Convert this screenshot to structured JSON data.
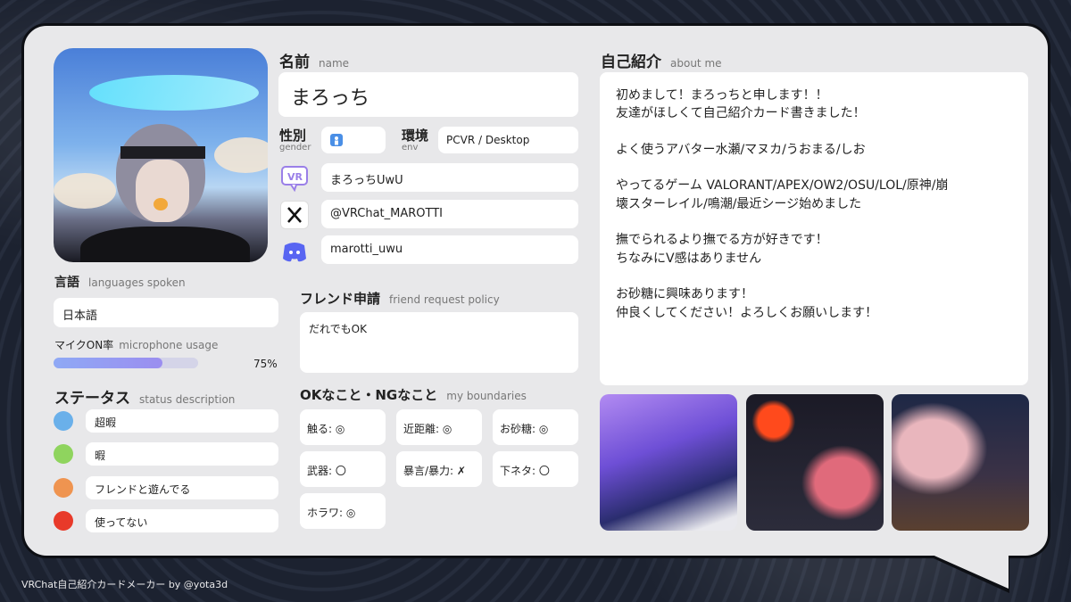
{
  "footer": "VRChat自己紹介カードメーカー by @yota3d",
  "name": {
    "label": "名前",
    "sub": "name",
    "value": "まろっち"
  },
  "gender": {
    "label": "性別",
    "sub": "gender",
    "icon": "male-symbol-icon"
  },
  "env": {
    "label": "環境",
    "sub": "env",
    "value": "PCVR / Desktop"
  },
  "accounts": {
    "vrchat": "まろっちUwU",
    "x": "@VRChat_MAROTTI",
    "discord": "marotti_uwu"
  },
  "languages": {
    "label": "言語",
    "sub": "languages spoken",
    "value": "日本語"
  },
  "mic": {
    "label": "マイクON率",
    "sub": "microphone usage",
    "value": "75%",
    "fraction": 0.75
  },
  "status": {
    "label": "ステータス",
    "sub": "status description",
    "items": [
      {
        "color": "#6ab0ea",
        "text": "超暇"
      },
      {
        "color": "#8fd45e",
        "text": "暇"
      },
      {
        "color": "#ef9450",
        "text": "フレンドと遊んでる"
      },
      {
        "color": "#e83a2a",
        "text": "使ってない"
      }
    ]
  },
  "friend": {
    "label": "フレンド申請",
    "sub": "friend request policy",
    "value": "だれでもOK"
  },
  "boundaries": {
    "label": "OKなこと・NGなこと",
    "sub": "my boundaries",
    "items": [
      "触る: ◎",
      "近距離: ◎",
      "お砂糖: ◎",
      "武器: 〇",
      "暴言/暴力: ✗",
      "下ネタ: 〇",
      "ホラワ: ◎"
    ]
  },
  "about": {
    "label": "自己紹介",
    "sub": "about me",
    "lines": [
      "初めまして！まろっちと申します！！",
      "友達がほしくて自己紹介カード書きました！",
      "",
      "よく使うアバター水瀬/マヌカ/うおまる/しお",
      "",
      "やってるゲーム VALORANT/APEX/OW2/OSU/LOL/原神/崩",
      "壊スターレイル/鳴潮/最近シージ始めました",
      "",
      "撫でられるより撫でる方が好きです！",
      "ちなみにV感はありません",
      "",
      "お砂糖に興味あります！",
      "仲良くしてください！よろしくお願いします！"
    ]
  }
}
